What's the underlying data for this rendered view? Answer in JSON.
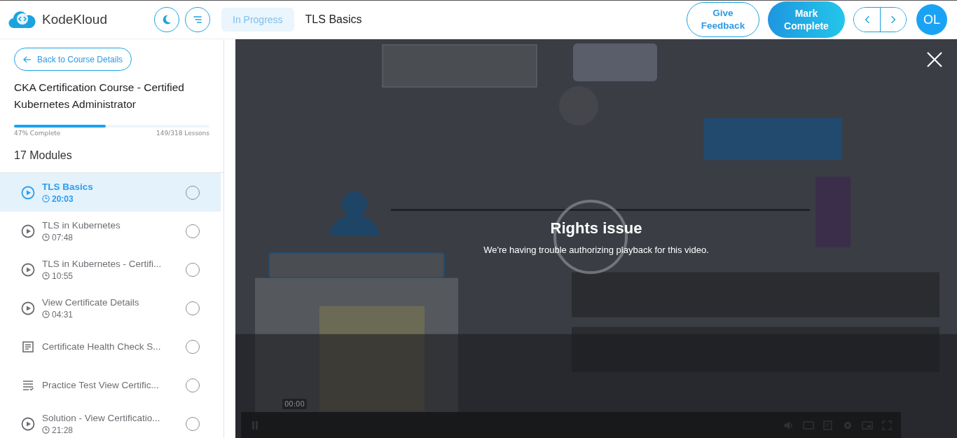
{
  "header": {
    "brand": "KodeKloud",
    "status": "In Progress",
    "lesson_title": "TLS Basics",
    "feedback_button": "Give Feedback",
    "complete_button": "Mark Complete",
    "avatar": "OL"
  },
  "sidebar": {
    "back_button": "Back to Course Details",
    "course_title": "CKA Certification Course - Certified Kubernetes Administrator",
    "progress": {
      "level": 0.47,
      "label": "47% Complete",
      "lessons": "149/318 Lessons"
    },
    "modules": "17 Modules",
    "lessons": [
      {
        "kind": "video",
        "title": "TLS Basics",
        "duration": "20:03",
        "selected": true,
        "done": false
      },
      {
        "kind": "video",
        "title": "TLS in Kubernetes",
        "duration": "07:48",
        "selected": false,
        "done": false
      },
      {
        "kind": "video",
        "title": "TLS in Kubernetes - Certifi...",
        "duration": "10:55",
        "selected": false,
        "done": false
      },
      {
        "kind": "video",
        "title": "View Certificate Details",
        "duration": "04:31",
        "selected": false,
        "done": false
      },
      {
        "kind": "article",
        "title": "Certificate Health Check S...",
        "selected": false,
        "done": false
      },
      {
        "kind": "quiz",
        "title": "Practice Test View Certific...",
        "selected": false,
        "done": false
      },
      {
        "kind": "video",
        "title": "Solution - View Certificatio...",
        "duration": "21:28",
        "selected": false,
        "done": false
      }
    ]
  },
  "player": {
    "kind": "picture",
    "error_title": "Rights issue",
    "error_message": "We're having trouble authorizing playback for this video.",
    "time_tooltip": "00:00"
  }
}
